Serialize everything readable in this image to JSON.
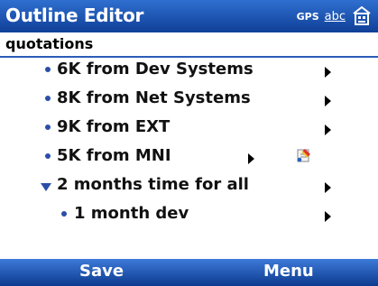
{
  "app_title": "Outline Editor",
  "tray": {
    "gps": "GPS",
    "input_mode": "abc",
    "keyboard_icon": "keyboard-icon"
  },
  "document_title": "quotations",
  "items": [
    {
      "label": "6K from Dev Systems",
      "level": 1,
      "expanded": false
    },
    {
      "label": "8K from Net Systems",
      "level": 1,
      "expanded": false
    },
    {
      "label": "9K from EXT",
      "level": 1,
      "expanded": false
    },
    {
      "label": "5K from MNI",
      "level": 1,
      "expanded": false,
      "has_note": true
    },
    {
      "label": "2 months time for all",
      "level": 1,
      "expanded": true
    },
    {
      "label": "1 month dev",
      "level": 2,
      "expanded": false
    }
  ],
  "softkeys": {
    "left": "Save",
    "right": "Menu"
  },
  "colors": {
    "titlebar": "#1f56b8",
    "bullet": "#2a4ea8",
    "softbar": "#1f56b8"
  }
}
